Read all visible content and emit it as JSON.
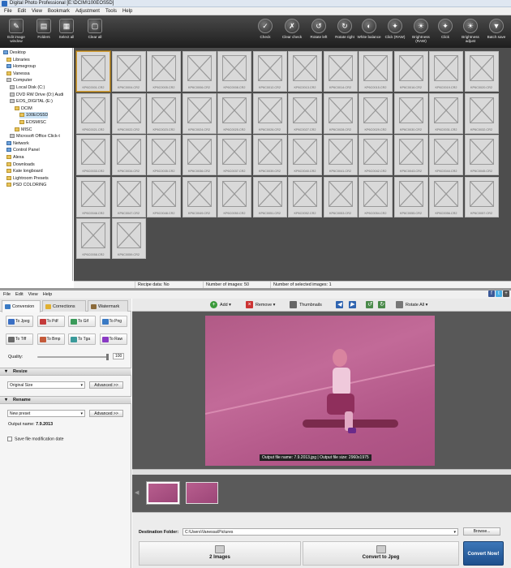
{
  "title": "Digital Photo Professional  [E:\\DCIM\\100EOS5D]",
  "menu_top": [
    "File",
    "Edit",
    "View",
    "Bookmark",
    "Adjustment",
    "Tools",
    "Help"
  ],
  "toolbar_top": [
    {
      "label": "Edit image window",
      "icon": "edit-image-icon"
    },
    {
      "label": "Folders",
      "icon": "folders-icon"
    },
    {
      "label": "Select all",
      "icon": "select-all-icon"
    },
    {
      "label": "Clear all",
      "icon": "clear-all-icon"
    },
    {
      "label": "Check",
      "icon": "check-icon"
    },
    {
      "label": "Clear check",
      "icon": "clear-check-icon"
    },
    {
      "label": "Rotate left",
      "icon": "rotate-left-icon"
    },
    {
      "label": "Rotate right",
      "icon": "rotate-right-icon"
    },
    {
      "label": "White balance",
      "icon": "white-balance-icon"
    },
    {
      "label": "Click (RAW)",
      "icon": "click-raw-icon"
    },
    {
      "label": "Brightness (RAW)",
      "icon": "brightness-raw-icon"
    },
    {
      "label": "Click",
      "icon": "click-icon"
    },
    {
      "label": "Brightness adjust",
      "icon": "brightness-adjust-icon"
    },
    {
      "label": "Batch save",
      "icon": "batch-save-icon"
    }
  ],
  "tree": [
    {
      "label": "Desktop",
      "icon": "blue"
    },
    {
      "label": "Libraries",
      "icon": "folder"
    },
    {
      "label": "Homegroup",
      "icon": "blue"
    },
    {
      "label": "Vanessa",
      "icon": "folder"
    },
    {
      "label": "Computer",
      "icon": "gray"
    },
    {
      "label": "Local Disk (C:)",
      "icon": "gray"
    },
    {
      "label": "DVD RW Drive (D:) Audi",
      "icon": "gray"
    },
    {
      "label": "EOS_DIGITAL (E:)",
      "icon": "gray"
    },
    {
      "label": "DCIM",
      "icon": "folder"
    },
    {
      "label": "100EOS5D",
      "icon": "folder"
    },
    {
      "label": "EOSMISC",
      "icon": "folder"
    },
    {
      "label": "MISC",
      "icon": "folder"
    },
    {
      "label": "Microsoft Office Click-t",
      "icon": "gray"
    },
    {
      "label": "Network",
      "icon": "blue"
    },
    {
      "label": "Control Panel",
      "icon": "blue"
    },
    {
      "label": "Alexa",
      "icon": "folder"
    },
    {
      "label": "Downloads",
      "icon": "folder"
    },
    {
      "label": "Kate longboard",
      "icon": "folder"
    },
    {
      "label": "Lightroom Presets",
      "icon": "folder"
    },
    {
      "label": "PSD COLORING",
      "icon": "folder"
    }
  ],
  "thumbnails": [
    "KP6C0001.CR2",
    "KP6C0004.CR2",
    "KP6C0005.CR2",
    "KP6C0006.CR2",
    "KP6C0008.CR2",
    "KP6C0012.CR2",
    "KP6C0013.CR2",
    "KP6C0014.CR2",
    "KP6C0015.CR2",
    "KP6C0016.CR2",
    "KP6C0019.CR2",
    "KP6C0020.CR2",
    "KP6C0021.CR2",
    "KP6C0022.CR2",
    "KP6C0023.CR2",
    "KP6C0024.CR2",
    "KP6C0025.CR2",
    "KP6C0026.CR2",
    "KP6C0027.CR2",
    "KP6C0028.CR2",
    "KP6C0029.CR2",
    "KP6C0030.CR2",
    "KP6C0031.CR2",
    "KP6C0032.CR2",
    "KP6C0033.CR2",
    "KP6C0034.CR2",
    "KP6C0035.CR2",
    "KP6C0036.CR2",
    "KP6C0037.CR2",
    "KP6C0039.CR2",
    "KP6C0040.CR2",
    "KP6C0041.CR2",
    "KP6C0042.CR2",
    "KP6C0043.CR2",
    "KP6C0044.CR2",
    "KP6C0045.CR2",
    "KP6C0046.CR2",
    "KP6C0047.CR2",
    "KP6C0048.CR2",
    "KP6C0049.CR2",
    "KP6C0050.CR2",
    "KP6C0051.CR2",
    "KP6C0052.CR2",
    "KP6C0053.CR2",
    "KP6C0054.CR2",
    "KP6C0055.CR2",
    "KP6C0056.CR2",
    "KP6C0057.CR2",
    "KP6C0058.CR2",
    "KP6C0059.CR2"
  ],
  "status_top": {
    "recipe": "Recipe data: No",
    "images": "Number of images: 50",
    "selected": "Number of selected images: 1"
  },
  "menu_bottom": [
    "File",
    "Edit",
    "View",
    "Help"
  ],
  "tabs": [
    "Conversion",
    "Corrections",
    "Watermark"
  ],
  "formats": [
    "To Jpeg",
    "To Pdf",
    "To Gif",
    "To Png",
    "To Tiff",
    "To Bmp",
    "To Tga",
    "To Raw"
  ],
  "quality_label": "Quality:",
  "quality_value": "100",
  "resize": {
    "header": "Resize",
    "option": "Original Size",
    "advanced": "Advanced >>"
  },
  "rename": {
    "header": "Rename",
    "option": "New preset",
    "advanced": "Advanced >>",
    "output_label": "Output name:",
    "output_value": "7.9.2013"
  },
  "save_mod_date": "Save file modification date",
  "toolbar_bottom": {
    "add": "Add",
    "remove": "Remove",
    "thumbnails": "Thumbnails",
    "rotate_all": "Rotate All"
  },
  "preview_caption": "Output file name: 7.9.2013.jpg | Output file size: 2960x1975",
  "destination": {
    "label": "Destination Folder:",
    "value": "C:\\Users\\Vanessa\\Pictures",
    "browse": "Browse..."
  },
  "steps": {
    "images": "2 Images",
    "convert": "Convert to Jpeg",
    "convert_now": "Convert Now!"
  }
}
